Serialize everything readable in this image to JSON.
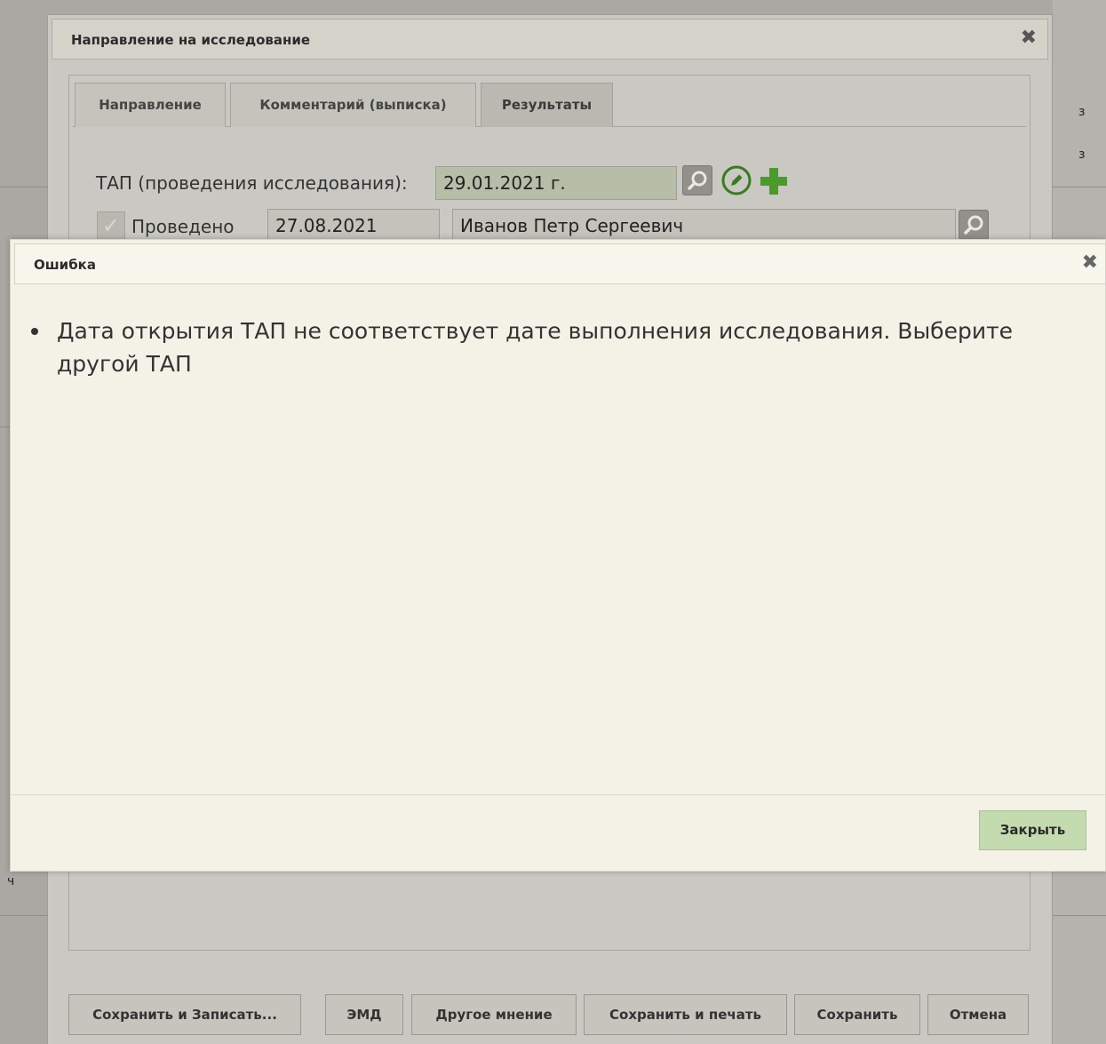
{
  "main_dialog": {
    "title": "Направление на исследование",
    "close_icon": "close-icon",
    "tabs": [
      {
        "label": "Направление"
      },
      {
        "label": "Комментарий (выписка)"
      },
      {
        "label": "Результаты",
        "active": true
      }
    ],
    "tap_label": "ТАП (проведения исследования):",
    "tap_value": "29.01.2021 г.",
    "done_checkbox_label": "Проведено",
    "done_date": "27.08.2021",
    "doctor": "Иванов Петр Сергеевич",
    "footer_buttons": {
      "save_and_record": "Сохранить и Записать...",
      "emd": "ЭМД",
      "other_opinion": "Другое мнение",
      "save_and_print": "Сохранить и печать",
      "save": "Сохранить",
      "cancel": "Отмена"
    }
  },
  "error_dialog": {
    "title": "Ошибка",
    "messages": [
      "Дата открытия ТАП не соответствует дате выполнения исследования. Выберите другой ТАП"
    ],
    "close_button": "Закрыть"
  },
  "background": {
    "chars": [
      "з",
      "з",
      "ч"
    ]
  },
  "colors": {
    "overlay": "#a9a8a2",
    "error_bg": "#f4f2e6",
    "close_button_bg": "#c4dbb0",
    "tap_field_bg": "#b7bea7",
    "accent_green": "#3a8a2a"
  }
}
